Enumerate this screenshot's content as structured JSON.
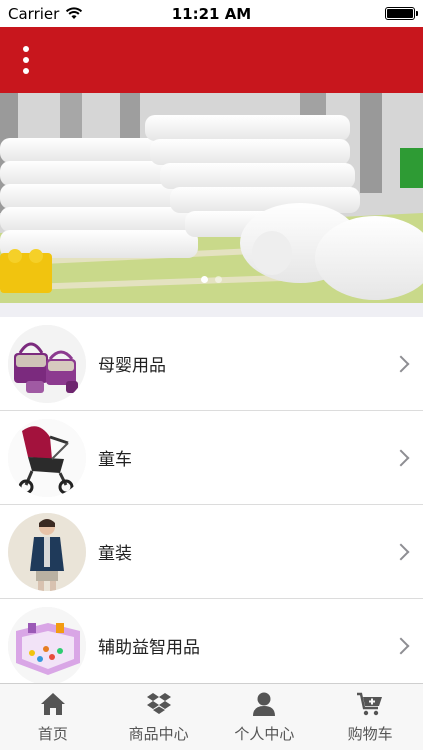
{
  "status_bar": {
    "carrier": "Carrier",
    "time": "11:21 AM"
  },
  "nav": {
    "menu_icon": "more-vertical-icon"
  },
  "banner": {
    "pages": 2,
    "current_page": 1
  },
  "categories": [
    {
      "label": "母婴用品",
      "icon": "baby-bags-image"
    },
    {
      "label": "童车",
      "icon": "stroller-image"
    },
    {
      "label": "童装",
      "icon": "kids-clothing-image"
    },
    {
      "label": "辅助益智用品",
      "icon": "play-fence-image"
    }
  ],
  "tabbar": {
    "items": [
      {
        "label": "首页",
        "icon": "home-icon"
      },
      {
        "label": "商品中心",
        "icon": "dropbox-box-icon"
      },
      {
        "label": "个人中心",
        "icon": "user-icon"
      },
      {
        "label": "购物车",
        "icon": "cart-add-icon"
      }
    ]
  },
  "colors": {
    "brand_red": "#c8161d",
    "tab_icon": "#555555"
  }
}
